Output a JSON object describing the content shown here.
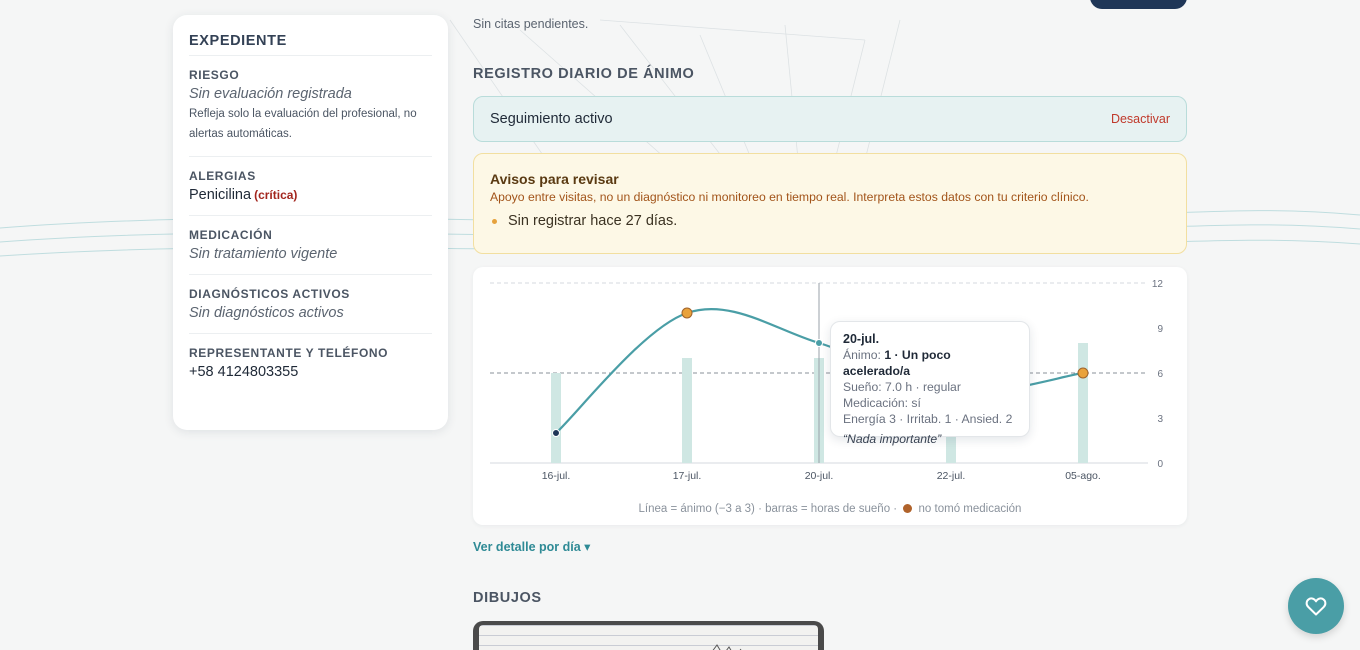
{
  "record": {
    "title": "EXPEDIENTE",
    "risk": {
      "label": "RIESGO",
      "value": "Sin evaluación registrada",
      "note": "Refleja solo la evaluación del profesional, no alertas automáticas."
    },
    "allergies": {
      "label": "ALERGIAS",
      "value": "Penicilina",
      "badge": "(crítica)"
    },
    "medication": {
      "label": "MEDICACIÓN",
      "value": "Sin tratamiento vigente"
    },
    "diagnoses": {
      "label": "DIAGNÓSTICOS ACTIVOS",
      "value": "Sin diagnósticos activos"
    },
    "contact": {
      "label": "REPRESENTANTE Y TELÉFONO",
      "value": "+58 4124803355"
    }
  },
  "appointments": {
    "note": "Sin citas pendientes."
  },
  "mood": {
    "heading": "REGISTRO DIARIO DE ÁNIMO",
    "tracking": {
      "status": "Seguimiento activo",
      "toggle": "Desactivar"
    },
    "alert": {
      "title": "Avisos para revisar",
      "description": "Apoyo entre visitas, no un diagnóstico ni monitoreo en tiempo real. Interpreta estos datos con tu criterio clínico.",
      "items": [
        "Sin registrar hace 27 días."
      ]
    },
    "caption": {
      "before": "Línea = ánimo (−3 a 3) · barras = horas de sueño ·",
      "after": "no tomó medicación"
    },
    "tooltip": {
      "date": "20-jul.",
      "mood_label": "Ánimo:",
      "mood_value": "1 · Un poco acelerado/a",
      "sleep": "Sueño: 7.0 h · regular",
      "medication": "Medicación: sí",
      "scores": "Energía 3 · Irritab. 1 · Ansied. 2",
      "quote": "“Nada importante”"
    },
    "detail_link": "Ver detalle por día ▾"
  },
  "drawings": {
    "heading": "DIBUJOS"
  },
  "colors": {
    "accent": "#4a9ea6",
    "sleep_bar": "#cfe7e3",
    "missed_med": "#e9a23b",
    "line": "#4a9ea6"
  },
  "icons": {
    "fab": "heart-icon"
  },
  "chart_data": {
    "type": "line",
    "categories": [
      "16-jul.",
      "17-jul.",
      "20-jul.",
      "22-jul.",
      "05-ago."
    ],
    "y_ticks": [
      0,
      3,
      6,
      9,
      12
    ],
    "ylim": [
      0,
      12
    ],
    "series": [
      {
        "values": [
          2,
          10,
          8,
          4.7,
          6
        ],
        "missed_medication": [
          false,
          true,
          false,
          false,
          true
        ]
      },
      {
        "type": "bar",
        "values": [
          6,
          7,
          7,
          4.5,
          8
        ]
      }
    ],
    "reference_lines": [
      6,
      12
    ],
    "grid": false
  }
}
